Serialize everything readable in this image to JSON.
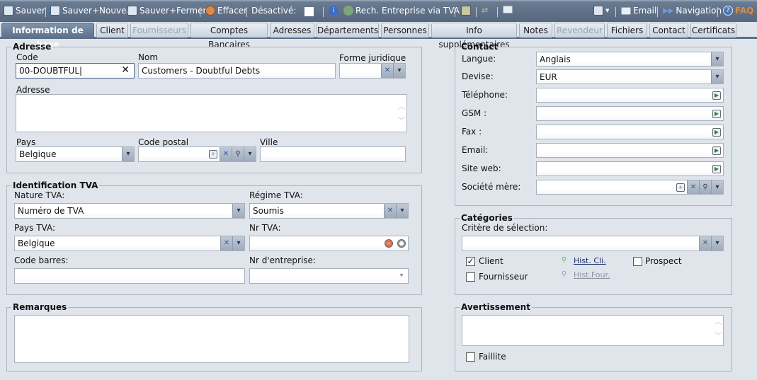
{
  "toolbar": {
    "save": "Sauver",
    "save_new": "Sauver+Nouveau",
    "save_close": "Sauver+Fermer",
    "delete": "Effacer",
    "disabled_label": "Désactivé:",
    "vat_search": "Rech. Entreprise via TVA",
    "email": "Email",
    "navigation": "Navigation",
    "faq": "FAQ"
  },
  "tabs": [
    {
      "label": "Information de base"
    },
    {
      "label": "Client"
    },
    {
      "label": "Fournisseurs"
    },
    {
      "label": "Comptes Bancaires"
    },
    {
      "label": "Adresses"
    },
    {
      "label": "Départements"
    },
    {
      "label": "Personnes"
    },
    {
      "label": "Info supplémentaires"
    },
    {
      "label": "Notes"
    },
    {
      "label": "Revendeur"
    },
    {
      "label": "Fichiers"
    },
    {
      "label": "Contact"
    },
    {
      "label": "Certificats"
    }
  ],
  "adresse": {
    "legend": "Adresse",
    "code_label": "Code",
    "code_value": "00-DOUBTFUL",
    "nom_label": "Nom",
    "nom_value": "Customers - Doubtful Debts",
    "forme_label": "Forme juridique",
    "forme_value": "",
    "adresse_label": "Adresse",
    "adresse_value": "",
    "pays_label": "Pays",
    "pays_value": "Belgique",
    "cp_label": "Code postal",
    "cp_value": "",
    "ville_label": "Ville",
    "ville_value": ""
  },
  "tva": {
    "legend": "Identification TVA",
    "nature_label": "Nature TVA:",
    "nature_value": "Numéro de TVA",
    "regime_label": "Régime TVA:",
    "regime_value": "Soumis",
    "pays_label": "Pays TVA:",
    "pays_value": "Belgique",
    "nr_label": "Nr TVA:",
    "nr_value": "",
    "barcode_label": "Code barres:",
    "barcode_value": "",
    "entreprise_label": "Nr d'entreprise:",
    "entreprise_value": ""
  },
  "remarques": {
    "legend": "Remarques",
    "value": ""
  },
  "contact": {
    "legend": "Contact",
    "rows": [
      {
        "label": "Langue:",
        "value": "Anglais"
      },
      {
        "label": "Devise:",
        "value": "EUR"
      },
      {
        "label": "Téléphone:",
        "value": ""
      },
      {
        "label": "GSM :",
        "value": ""
      },
      {
        "label": "Fax :",
        "value": ""
      },
      {
        "label": "Email:",
        "value": ""
      },
      {
        "label": "Site web:",
        "value": ""
      },
      {
        "label": "Société mère:",
        "value": ""
      }
    ]
  },
  "categories": {
    "legend": "Catégories",
    "criteria_label": "Critère de sélection:",
    "criteria_value": "",
    "client": "Client",
    "client_checked": true,
    "fournisseur": "Fournisseur",
    "fournisseur_checked": false,
    "prospect": "Prospect",
    "prospect_checked": false,
    "hist_cli": "Hist. Cli.",
    "hist_four": "Hist.Four."
  },
  "avertissement": {
    "legend": "Avertissement",
    "value": "",
    "faillite": "Faillite",
    "faillite_checked": false
  },
  "colors": {
    "toolbar": "#5f7088",
    "active_tab": "#5b6e88",
    "faq": "#e08a3c",
    "background": "#dfe5eb"
  }
}
